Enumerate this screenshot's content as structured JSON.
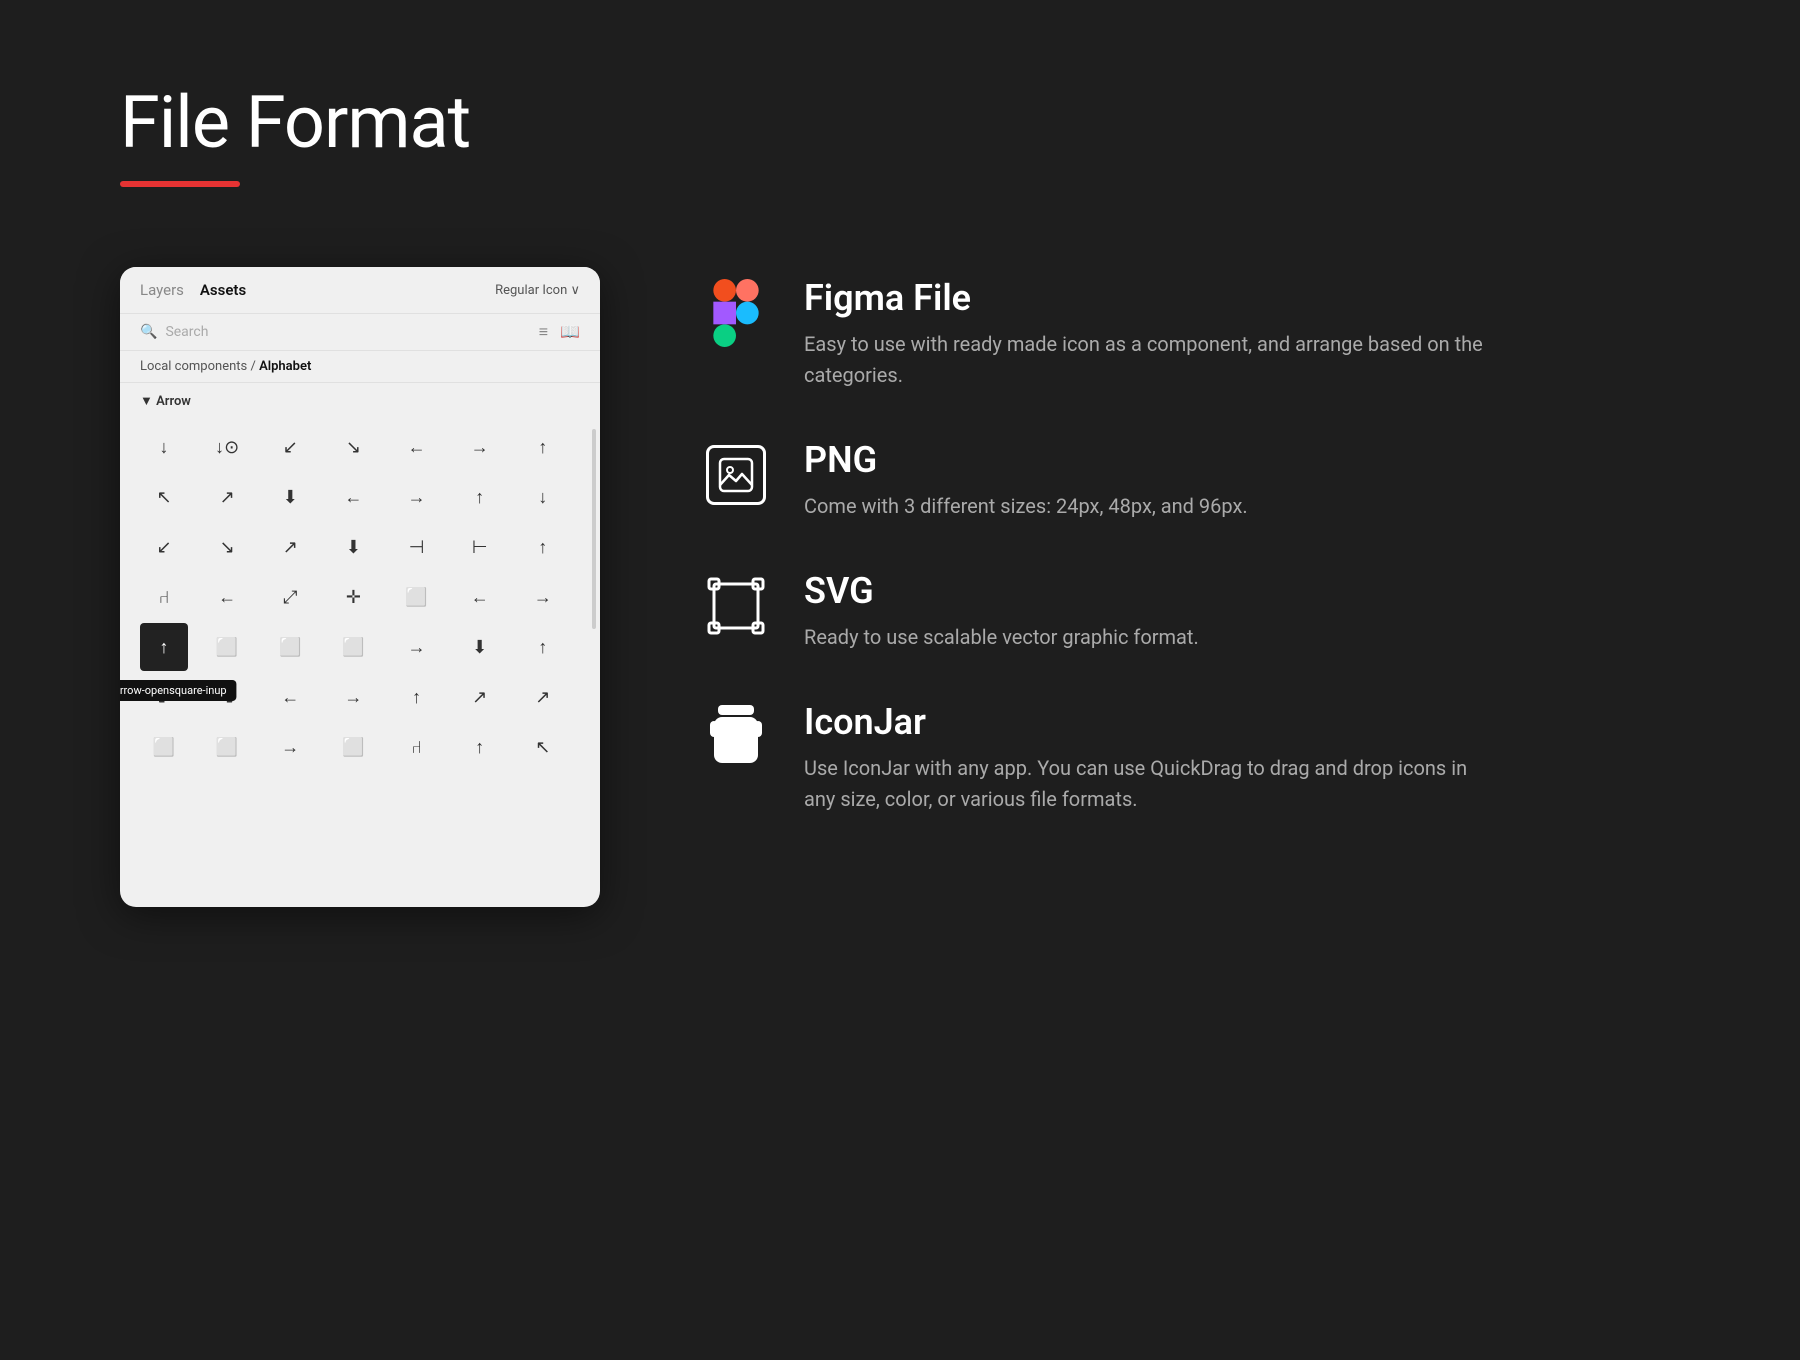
{
  "page": {
    "title": "File Format",
    "accent_color": "#e63333",
    "bg_color": "#1e1e1e"
  },
  "panel": {
    "tabs": [
      {
        "label": "Layers",
        "active": false
      },
      {
        "label": "Assets",
        "active": true
      }
    ],
    "dropdown": "Regular Icon ∨",
    "search_placeholder": "Search",
    "breadcrumb_prefix": "Local components /",
    "breadcrumb_current": "Alphabet",
    "section_label": "▼ Arrow",
    "tooltip_text": "sr-arrow-opensquare-inup"
  },
  "formats": [
    {
      "id": "figma",
      "title": "Figma File",
      "description": "Easy to use with ready made icon as a component, and arrange based on the categories.",
      "icon_type": "figma"
    },
    {
      "id": "png",
      "title": "PNG",
      "description": "Come with 3 different sizes: 24px, 48px, and 96px.",
      "icon_type": "png"
    },
    {
      "id": "svg",
      "title": "SVG",
      "description": "Ready to use scalable vector graphic format.",
      "icon_type": "svg"
    },
    {
      "id": "iconjar",
      "title": "IconJar",
      "description": "Use IconJar with any app. You can use QuickDrag to drag and drop icons in any size, color, or various file formats.",
      "icon_type": "iconjar"
    }
  ],
  "grid_symbols": [
    "↓",
    "⊙",
    "↙",
    "↘",
    "←",
    "→",
    "↑",
    "↖",
    "↗",
    "⬇",
    "(←",
    "→)",
    "↑",
    "↓",
    "↙",
    "↘",
    "↗",
    "⬇",
    "⊣",
    "→⊣",
    "↑",
    "⑁",
    "←",
    "⤢",
    "✛",
    "⊡",
    "⟵",
    "⊡",
    "⊡",
    "⊡",
    "⊡",
    "⊡",
    "→",
    "⊡",
    "⊡",
    "⊡",
    "⊡",
    "←",
    "→",
    "↑",
    "⊡",
    "⊡",
    "⊡",
    "⊡",
    "⊡",
    "⊡",
    "⊡",
    "⊡",
    "⊡"
  ]
}
